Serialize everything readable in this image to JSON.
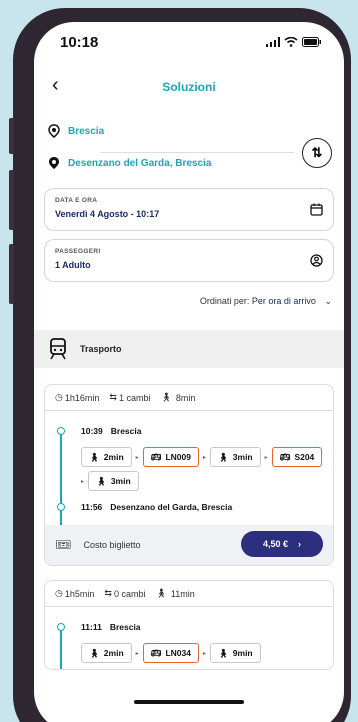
{
  "status": {
    "time": "10:18"
  },
  "header": {
    "title": "Soluzioni"
  },
  "route": {
    "from": "Brescia",
    "to": "Desenzano del Garda, Brescia"
  },
  "date_box": {
    "label": "DATA E ORA",
    "value": "Venerdì 4 Agosto - 10:17"
  },
  "passengers_box": {
    "label": "PASSEGGERI",
    "value": "1 Adulto"
  },
  "sort": {
    "label": "Ordinati per:",
    "value": "Per ora di arrivo"
  },
  "section": {
    "label": "Trasporto"
  },
  "solutions": [
    {
      "duration": "1h16min",
      "changes": "1 cambi",
      "walk": "8min",
      "departure_time": "10:39",
      "departure": "Brescia",
      "legs_row1": [
        "2min",
        "LN009",
        "3min"
      ],
      "legs_row2": [
        "S204",
        "3min"
      ],
      "arrival_time": "11:56",
      "arrival": "Desenzano del Garda, Brescia",
      "cost_label": "Costo biglietto",
      "price": "4,50 €"
    },
    {
      "duration": "1h5min",
      "changes": "0 cambi",
      "walk": "11min",
      "departure_time": "11:11",
      "departure": "Brescia",
      "legs_row1": [
        "2min",
        "LN034",
        "9min"
      ]
    }
  ],
  "colors": {
    "accent": "#1aa6b8",
    "navy": "#2b2f7e",
    "bus_border": "#e8642a",
    "frame": "#2e2630"
  }
}
